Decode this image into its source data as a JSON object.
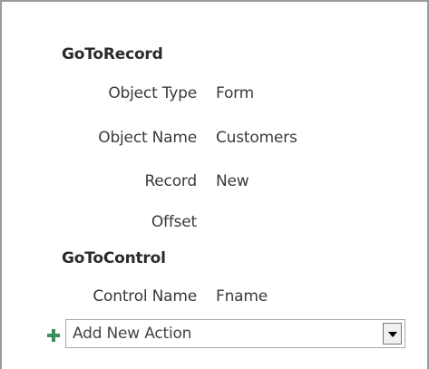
{
  "actions": [
    {
      "title": "GoToRecord",
      "arguments": [
        {
          "label": "Object Type",
          "value": "Form"
        },
        {
          "label": "Object Name",
          "value": "Customers"
        },
        {
          "label": "Record",
          "value": "New"
        },
        {
          "label": "Offset",
          "value": ""
        }
      ]
    },
    {
      "title": "GoToControl",
      "arguments": [
        {
          "label": "Control Name",
          "value": "Fname"
        }
      ]
    }
  ],
  "add_action": {
    "value": "Add New Action",
    "plus_icon": "plus-icon",
    "dropdown_icon": "chevron-down-icon",
    "plus_color": "#3a8f5a"
  }
}
